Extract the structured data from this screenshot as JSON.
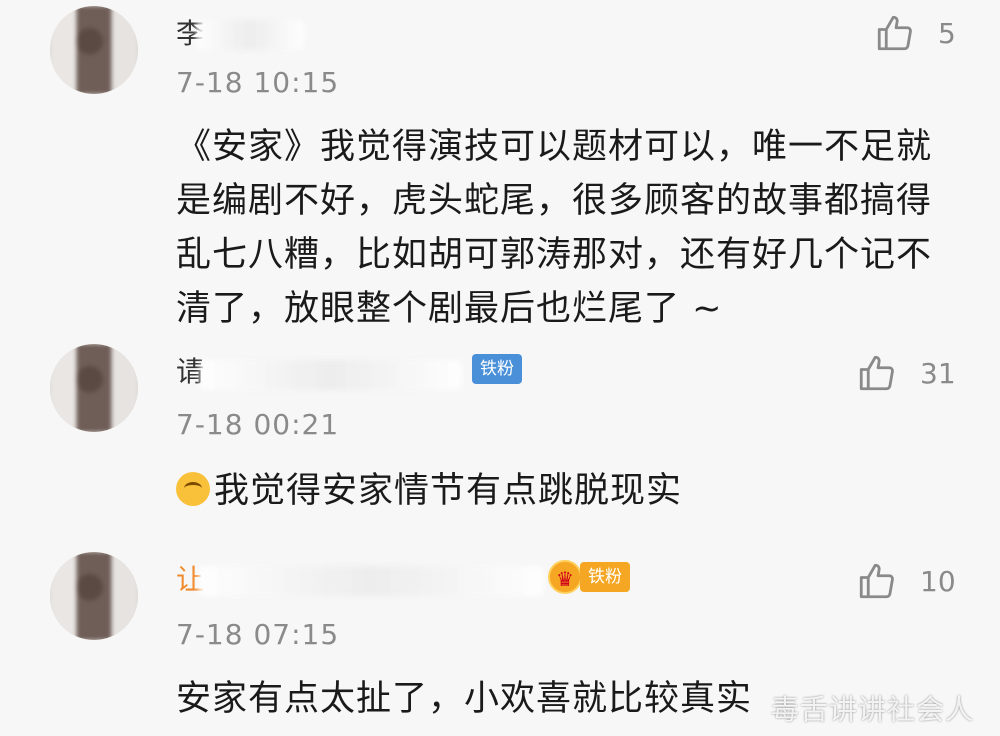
{
  "comments": [
    {
      "username": "李",
      "time": "7-18 10:15",
      "likes": "5",
      "text": "《安家》我觉得演技可以题材可以，唯一不足就是编剧不好，虎头蛇尾，很多顾客的故事都搞得乱七八糟，比如胡可郭涛那对，还有好几个记不清了，放眼整个剧最后也烂尾了 ~"
    },
    {
      "username": "请",
      "badge": "铁粉",
      "time": "7-18 00:21",
      "likes": "31",
      "text": "我觉得安家情节有点跳脱现实"
    },
    {
      "username": "让",
      "badge": "铁粉",
      "time": "7-18 07:15",
      "likes": "10",
      "text": "安家有点太扯了，小欢喜就比较真实"
    }
  ],
  "watermark": "毒舌讲讲社会人",
  "colors": {
    "vip_name": "#f08a2b",
    "badge_blue": "#4a90d9",
    "badge_gold": "#f5a623",
    "meta_gray": "#8a8a8a"
  }
}
